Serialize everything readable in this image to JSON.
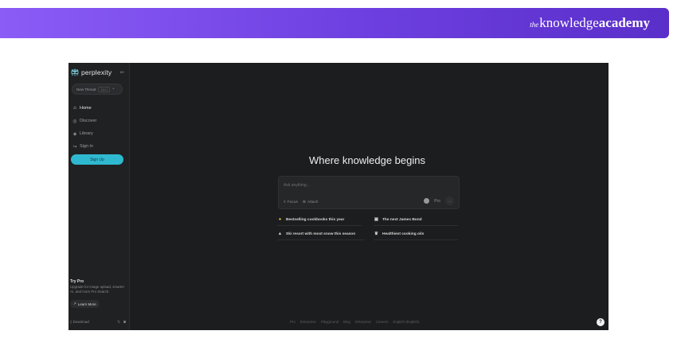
{
  "banner": {
    "brand_the": "the",
    "brand_knowledge": "knowledge",
    "brand_academy": "academy"
  },
  "sidebar": {
    "logo_text": "perplexity",
    "new_thread": {
      "label": "New Thread",
      "shortcut": "Ctrl I",
      "plus": "+"
    },
    "nav": [
      {
        "label": "Home",
        "icon": "home-icon"
      },
      {
        "label": "Discover",
        "icon": "compass-icon"
      },
      {
        "label": "Library",
        "icon": "library-icon"
      },
      {
        "label": "Sign in",
        "icon": "sign-in-icon"
      }
    ],
    "signup_label": "Sign Up",
    "try_pro": {
      "title": "Try Pro",
      "description": "Upgrade for image upload, smarter AI, and more Pro Search.",
      "learn_more": "Learn More"
    },
    "footer": {
      "download": "Download"
    }
  },
  "main": {
    "headline": "Where knowledge begins",
    "ask": {
      "placeholder": "Ask anything...",
      "focus": "Focus",
      "attach": "Attach",
      "pro": "Pro"
    },
    "suggestions": [
      {
        "label": "Bestselling cookbooks this year",
        "icon": "sun-icon"
      },
      {
        "label": "The next James Bond",
        "icon": "film-icon"
      },
      {
        "label": "Ski resort with most snow this season",
        "icon": "mountain-icon"
      },
      {
        "label": "Healthiest cooking oils",
        "icon": "trophy-icon"
      }
    ],
    "footer_links": [
      "Pro",
      "Enterprise",
      "Playground",
      "Blog",
      "Enterprise",
      "Careers",
      "English (English)"
    ],
    "help": "?"
  },
  "colors": {
    "accent": "#2fb9d0",
    "background": "#1c1d1f",
    "sidebar": "#202123",
    "banner_start": "#8b5cf6",
    "banner_end": "#5a2fc9"
  }
}
